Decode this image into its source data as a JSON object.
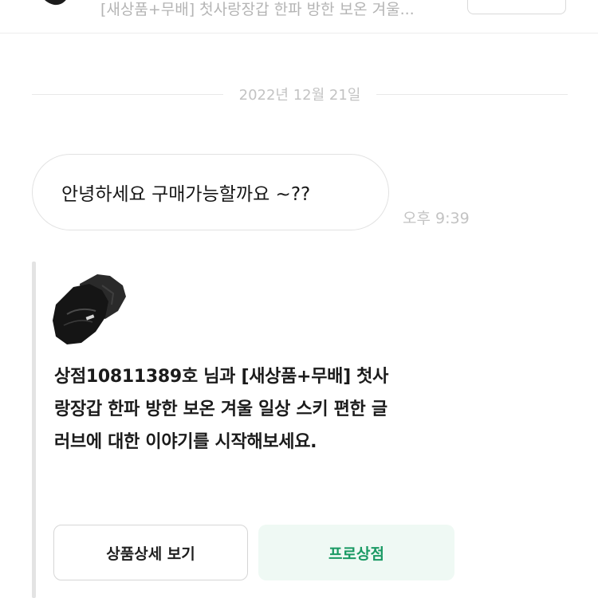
{
  "product_bar": {
    "thumbnail_icon": "glove-icon",
    "title": "[새상품+무배] 첫사랑장갑 한파 방한 보온 겨울..."
  },
  "chat": {
    "date": "2022년 12월 21일",
    "message": {
      "text": "안녕하세요 구매가능할까요 ~??",
      "time": "오후 9:39"
    }
  },
  "system_card": {
    "thumbnail_icon": "glove-icon",
    "lines": [
      "상점10811389호 님과 [새상품+무배] 첫사",
      "랑장갑 한파 방한 보온 겨울 일상 스키 편한 글",
      "러브에 대한 이야기를 시작해보세요."
    ],
    "buttons": {
      "detail": "상품상세 보기",
      "pro_store": "프로상점"
    }
  },
  "colors": {
    "accent_green": "#1a9a64",
    "accent_green_bg": "#eff9f4",
    "muted_text": "#c3c3c3"
  }
}
